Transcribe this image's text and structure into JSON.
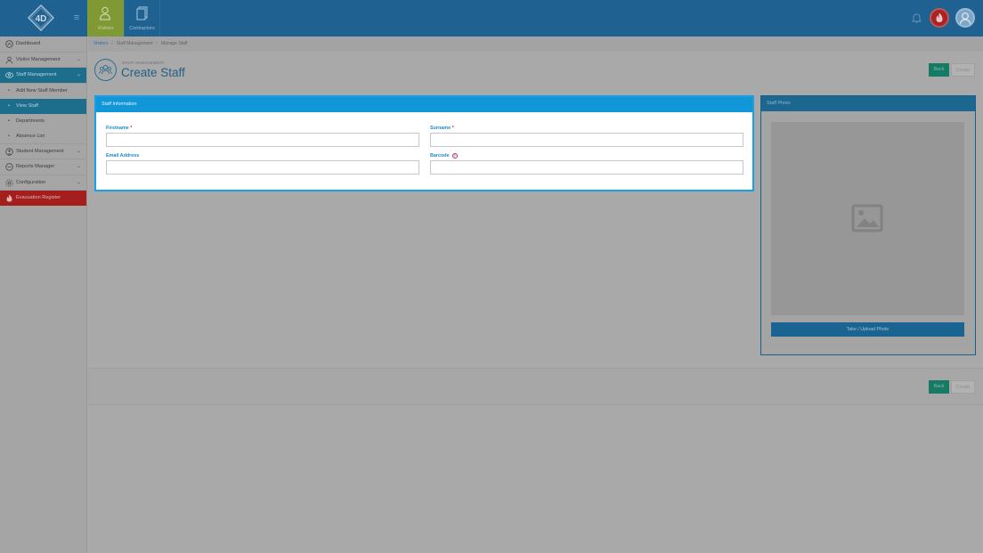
{
  "topbar": {
    "logo_text": "4D",
    "nav": [
      {
        "label": "Visitors",
        "icon": "visitor-person-icon",
        "active": true
      },
      {
        "label": "Contractors",
        "icon": "contractor-document-icon",
        "active": false
      }
    ],
    "icons": [
      "menu-icon",
      "bell-icon",
      "fire-icon",
      "user-avatar-icon"
    ]
  },
  "sidebar": {
    "items": [
      {
        "label": "Dashboard",
        "icon": "dashboard-icon"
      },
      {
        "label": "Visitor Management",
        "icon": "person-icon"
      },
      {
        "label": "Staff Management",
        "icon": "staff-group-icon",
        "active": true
      },
      {
        "label": "Add New Staff Member"
      },
      {
        "label": "View Staff",
        "selected": true
      },
      {
        "label": "Departments"
      },
      {
        "label": "Absence List"
      },
      {
        "label": "Student Management",
        "icon": "student-icon"
      },
      {
        "label": "Reports Manager",
        "icon": "reports-icon"
      },
      {
        "label": "Configuration",
        "icon": "gear-icon"
      },
      {
        "label": "Evacuation Register",
        "icon": "fire-icon"
      }
    ]
  },
  "breadcrumb": [
    "Visitors",
    "Staff Management",
    "Manage Staff"
  ],
  "header": {
    "kicker": "STAFF MANAGEMENT",
    "title": "Create Staff",
    "back_label": "Back",
    "create_label": "Create"
  },
  "form": {
    "panel_title": "Staff Information",
    "firstname_label": "Firstname",
    "surname_label": "Surname",
    "email_label": "Email Address",
    "barcode_label": "Barcode",
    "required_mark": "*",
    "help_mark": "?"
  },
  "photo": {
    "panel_title": "Staff Photo",
    "upload_label": "Take / Upload Photo"
  },
  "footer": {
    "back_label": "Back",
    "create_label": "Create"
  },
  "colors": {
    "topbar": "#1f6291",
    "accent": "#1196d8",
    "active_nav": "#7f9a35",
    "back_button": "#157b65",
    "evacuation": "#a41e1e"
  }
}
